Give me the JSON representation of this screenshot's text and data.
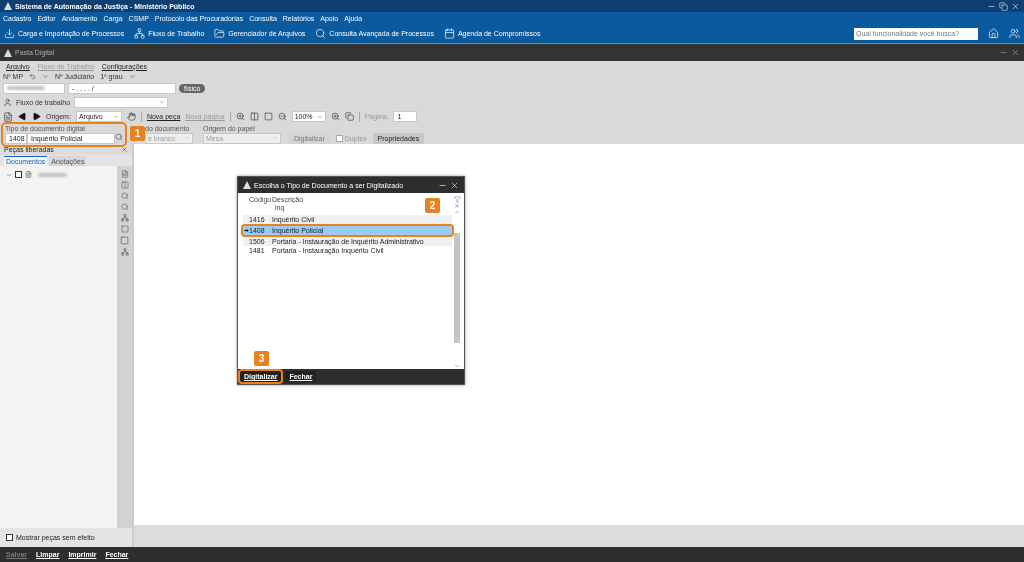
{
  "window": {
    "title": "Sistema de Automação da Justiça - Ministério Público"
  },
  "menu": [
    "Cadastro",
    "Editor",
    "Andamento",
    "Carga",
    "CSMP",
    "Protocolo das Procuradorias",
    "Consulta",
    "Relatórios",
    "Apoio",
    "Ajuda"
  ],
  "toolbar": [
    {
      "label": "Carga e Importação de Processos",
      "kind": "download"
    },
    {
      "label": "Fluxo de Trabalho",
      "kind": "flow"
    },
    {
      "label": "Gerenciador de Arquivos",
      "kind": "folder"
    },
    {
      "label": "Consulta Avançada de Processos",
      "kind": "search"
    },
    {
      "label": "Agenda de Compromissos",
      "kind": "calendar"
    }
  ],
  "search": {
    "placeholder": "Qual funcionalidade você busca?"
  },
  "subwindow": {
    "title": "Pasta Digital"
  },
  "sub_menu": [
    {
      "label": "Arquivo",
      "disabled": false
    },
    {
      "label": "Fluxo de Trabalho",
      "disabled": true
    },
    {
      "label": "Configurações",
      "disabled": false
    }
  ],
  "case": {
    "mp_label": "Nº MP",
    "judicial_label": "Nº Judiciário",
    "instance": "1º grau",
    "judicial_value": "- . . . . /",
    "badge": "físico"
  },
  "workflow": {
    "label": "Fluxo de trabalho"
  },
  "scan_toolbar": {
    "origin_label": "Origem:",
    "origin_value": "Arquivo",
    "new_piece": "Nova peça",
    "new_page": "Nova página",
    "new_page_disabled": true,
    "zoom": "100%",
    "page_label": "Página:",
    "page_value": "1"
  },
  "doc_fields": {
    "type_label": "Tipo de documento digital",
    "type_code": "1408",
    "type_name": "Inquérito Policial",
    "callout": "1",
    "side_label": "do documento",
    "side_value": "e branco",
    "paper_label": "Origem do papel",
    "paper_value": "Mesa",
    "scan_button": {
      "label": "Digitalizar",
      "disabled": true
    },
    "duplex": {
      "label": "Duplex",
      "checked": false
    },
    "properties_button": "Propriedades"
  },
  "panel": {
    "title": "Peças liberadas",
    "tabs": [
      {
        "label": "Documentos",
        "selected": true
      },
      {
        "label": "Anotações",
        "selected": false
      }
    ],
    "tree": [
      {
        "checked": false
      }
    ],
    "show_no_effect": {
      "label": "Mostrar peças sem efeito",
      "checked": false
    }
  },
  "dialog": {
    "title": "Escolha o Tipo de Documento a ser Digitalizado",
    "columns": [
      "Código",
      "Descrição"
    ],
    "filter": "inq",
    "rows": [
      {
        "code": "1416",
        "name": "Inquérito Civil",
        "selected": false
      },
      {
        "code": "1408",
        "name": "Inquérito Policial",
        "selected": true,
        "callout": "2"
      },
      {
        "code": "1506",
        "name": "Portaria - Instauração de Inquérito Administrativo",
        "selected": false
      },
      {
        "code": "1481",
        "name": "Portaria - Instauração Inquérito Civil",
        "selected": false
      }
    ],
    "buttons": [
      {
        "label": "Digitalizar",
        "callout": "3"
      },
      {
        "label": "Fechar"
      }
    ]
  },
  "footer": [
    {
      "label": "Salvar",
      "disabled": true
    },
    {
      "label": "Limpar",
      "disabled": false
    },
    {
      "label": "Imprimir",
      "disabled": false
    },
    {
      "label": "Fechar",
      "disabled": false
    }
  ]
}
